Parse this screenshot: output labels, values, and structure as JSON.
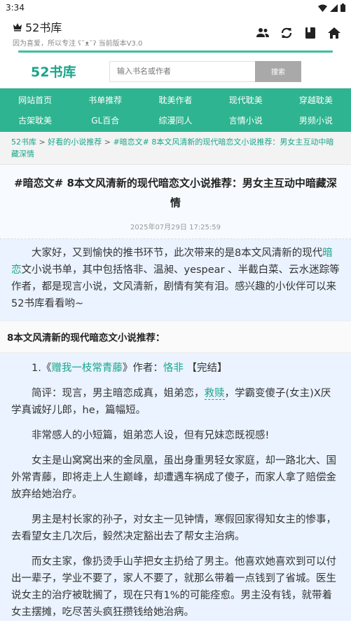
{
  "status": {
    "time": "3:34"
  },
  "app": {
    "title": "52书库",
    "subtitle": "因为喜爱，所以专注 ʕ˘ᴥ˘ʔ 当前版本V3.0"
  },
  "site": {
    "logo": "52书库",
    "search_placeholder": "输入书名或作者",
    "search_button": "搜索"
  },
  "nav": {
    "row1": [
      "网站首页",
      "书单推荐",
      "耽美作者",
      "现代耽美",
      "穿越耽美"
    ],
    "row2": [
      "古架耽美",
      "GL百合",
      "综漫同人",
      "言情小说",
      "男频小说"
    ]
  },
  "breadcrumb": {
    "home": "52书库",
    "sep": " > ",
    "category": "好看的小说推荐",
    "current": "#暗恋文# 8本文风清新的现代暗恋文小说推荐：男女主互动中暗藏深情"
  },
  "article": {
    "title": "#暗恋文# 8本文风清新的现代暗恋文小说推荐：男女主互动中暗藏深情",
    "date": "2025年07月29日 17:25:59",
    "intro_before": "大家好，又到愉快的推书环节，此次带来的是8本文风清新的现代",
    "intro_keyword": "暗恋",
    "intro_after": "文小说书单，其中包括恪非、温昶、yespear 、半截白菜、云水迷踪等作者，都是现言小说，文风清新，剧情有笑有泪。感兴趣的小伙伴可以来52书库看看哟~"
  },
  "section": {
    "title": "8本文风清新的现代暗恋文小说推荐："
  },
  "book1": {
    "prefix": "1.《",
    "title": "赠我一枝常青藤",
    "mid": "》作者：",
    "author": "恪非",
    "status": " 【完结】",
    "review_before": "简评：现言，男主暗恋成真，姐弟恋，",
    "review_link": "救赎",
    "review_after": "，学霸变傻子(女主)X厌学真诚好儿郎，he，篇幅短。",
    "p2": "非常感人的小短篇，姐弟恋人设，但有兄妹恋既视感!",
    "p3": "女主是山窝窝出来的金凤凰，虽出身重男轻女家庭，却一路北大、国外常青藤，即将走上人生巅峰，却遭遇车祸成了傻子，而家人拿了赔偿金放弃给她治疗。",
    "p4": "男主是村长家的孙子，对女主一见钟情，寒假回家得知女主的惨事，去看望女主几次后，毅然决定豁出去了帮女主治病。",
    "p5": "而女主家，像扔烫手山芋把女主扔给了男主。他喜欢她喜欢到可以付出一辈子，学业不要了，家人不要了，就那么带着一点钱到了省城。医生说女主的治疗被耽搁了，现在只有1%的可能痊愈。男主没有钱，就带着女主摆摊，吃尽苦头疯狂攒钱给她治病。"
  },
  "colors": {
    "accent": "#2eb490",
    "link": "#1aa58a",
    "bg_blue": "#eaf3ff"
  },
  "icons": [
    "wifi-icon",
    "signal-icon",
    "battery-icon",
    "crown-icon",
    "group-icon",
    "refresh-icon",
    "book-icon",
    "home-icon"
  ]
}
